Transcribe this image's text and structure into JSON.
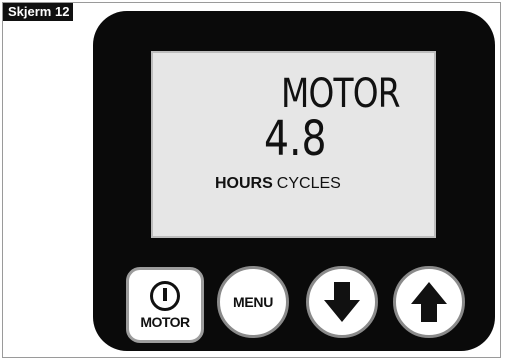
{
  "screen_label": "Skjerm 12",
  "display": {
    "mode_title": "MOTOR",
    "value": "4.8",
    "unit_selected": "HOURS",
    "unit_other": "CYCLES"
  },
  "buttons": {
    "motor_label": "MOTOR",
    "menu_label": "MENU"
  },
  "icons": {
    "motor_button": "power-icon",
    "down_button": "arrow-down-icon",
    "up_button": "arrow-up-icon"
  },
  "colors": {
    "device_body": "#0a0a0a",
    "lcd_background": "#e6e6e6",
    "button_face": "#ffffff",
    "label_background": "#111111"
  }
}
